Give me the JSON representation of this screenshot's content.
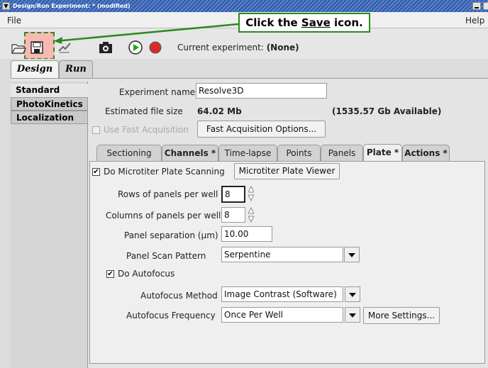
{
  "window": {
    "title": "Design/Run Experiment: * (modified)",
    "menu_icon": "chevron-down-icon"
  },
  "menu": {
    "file": "File",
    "help": "Help"
  },
  "callout": {
    "prefix": "Click the ",
    "keyword": "Save",
    "suffix": " icon."
  },
  "toolbar": {
    "current_label": "Current experiment:",
    "current_value": "(None)",
    "icons": [
      "open-folder-icon",
      "save-icon",
      "mark-icon",
      "camera-icon",
      "play-icon",
      "record-icon"
    ]
  },
  "tabs": {
    "design": "Design",
    "run": "Run"
  },
  "left_list": {
    "items": [
      "Standard",
      "PhotoKinetics",
      "Localization"
    ]
  },
  "experiment": {
    "name_label": "Experiment name",
    "name_value": "Resolve3D",
    "size_label": "Estimated file size",
    "size_value": "64.02 Mb",
    "available": "(1535.57 Gb Available)",
    "fast_acq_label": "Use Fast Acquisition",
    "fast_acq_button": "Fast Acquisition Options..."
  },
  "inner_tabs": [
    "Sectioning",
    "Channels *",
    "Time-lapse",
    "Points",
    "Panels",
    "Plate *",
    "Actions *"
  ],
  "plate": {
    "do_scanning_label": "Do Microtiter Plate Scanning",
    "do_scanning_checked": "✔",
    "viewer_button": "Microtiter Plate Viewer",
    "rows_label": "Rows of panels per well",
    "rows_value": "8",
    "cols_label": "Columns of panels per well",
    "cols_value": "8",
    "sep_label": "Panel separation (µm)",
    "sep_value": "10.00",
    "pattern_label": "Panel Scan Pattern",
    "pattern_value": "Serpentine",
    "autofocus_label": "Do Autofocus",
    "autofocus_checked": "✔",
    "af_method_label": "Autofocus Method",
    "af_method_value": "Image Contrast (Software)",
    "af_freq_label": "Autofocus Frequency",
    "af_freq_value": "Once Per Well",
    "more_settings_button": "More Settings..."
  }
}
